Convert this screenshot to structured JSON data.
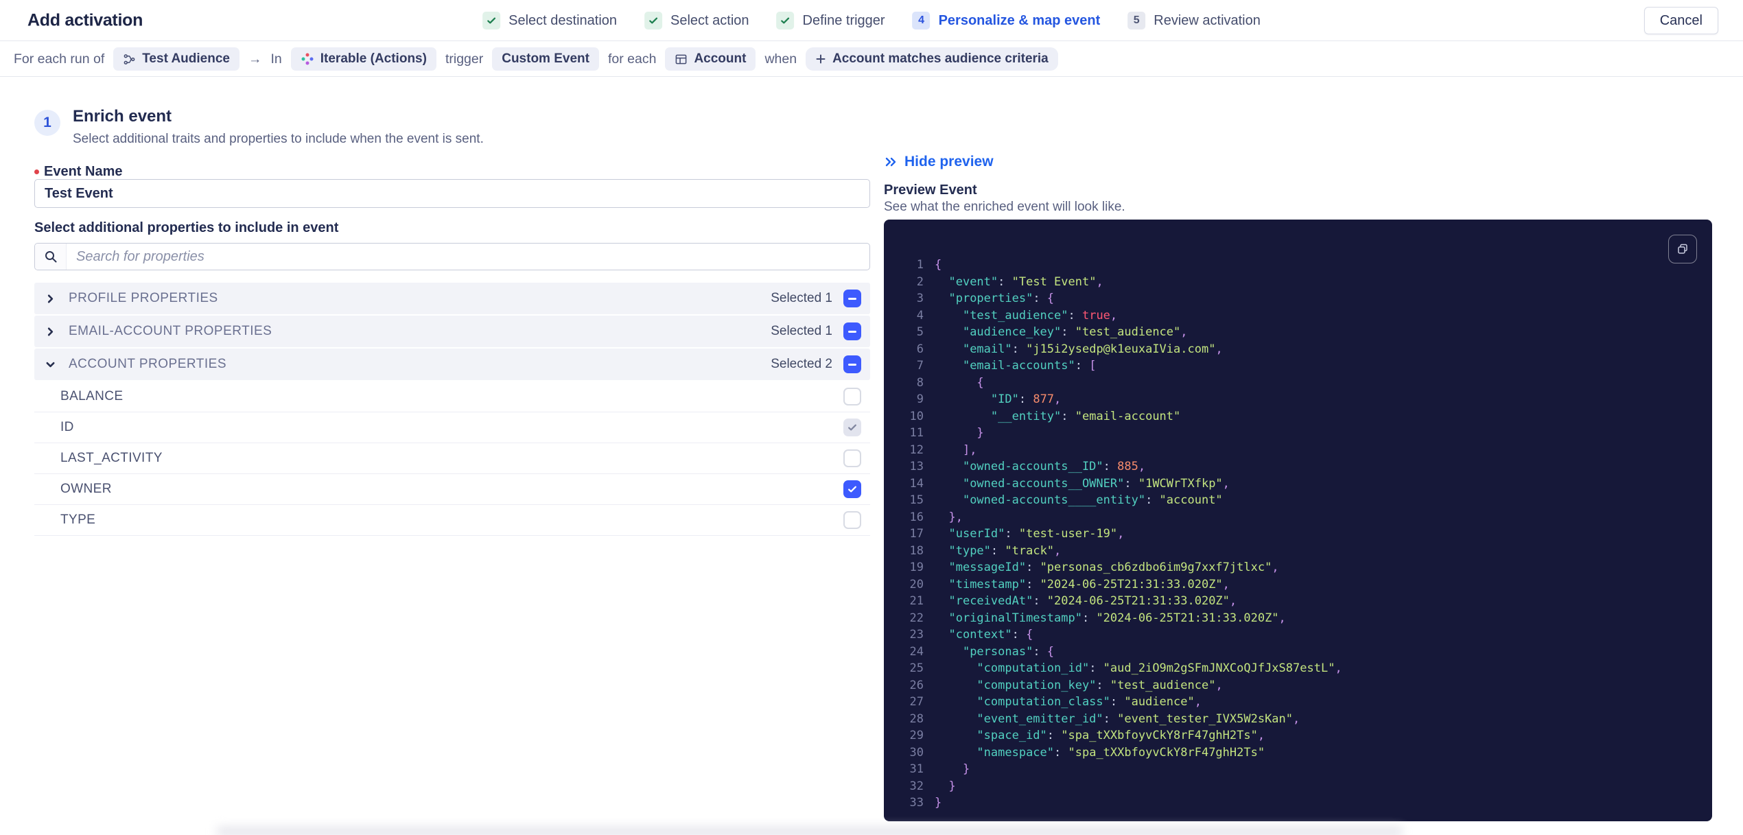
{
  "header": {
    "title": "Add activation",
    "cancel_label": "Cancel",
    "steps": [
      {
        "label": "Select destination",
        "state": "done",
        "number": ""
      },
      {
        "label": "Select action",
        "state": "done",
        "number": ""
      },
      {
        "label": "Define trigger",
        "state": "done",
        "number": ""
      },
      {
        "label": "Personalize & map event",
        "state": "active",
        "number": "4"
      },
      {
        "label": "Review activation",
        "state": "upcoming",
        "number": "5"
      }
    ]
  },
  "trigger_bar": {
    "prefix": "For each run of",
    "audience_chip": "Test Audience",
    "arrow": "→",
    "in_label": "In",
    "destination_chip": "Iterable (Actions)",
    "trigger_label": "trigger",
    "event_chip": "Custom Event",
    "for_each_label": "for each",
    "entity_chip": "Account",
    "when_label": "when",
    "condition_chip": "Account matches audience criteria"
  },
  "enrich": {
    "step_number": "1",
    "title": "Enrich event",
    "subtitle": "Select additional traits and properties to include when the event is sent.",
    "event_name_label": "Event Name",
    "event_name_value": "Test Event",
    "properties_label": "Select additional properties to include in event",
    "search_placeholder": "Search for properties",
    "groups": [
      {
        "label": "PROFILE PROPERTIES",
        "selected": "Selected 1",
        "expanded": false,
        "items": []
      },
      {
        "label": "EMAIL-ACCOUNT PROPERTIES",
        "selected": "Selected 1",
        "expanded": false,
        "items": []
      },
      {
        "label": "ACCOUNT PROPERTIES",
        "selected": "Selected 2",
        "expanded": true,
        "items": [
          {
            "label": "BALANCE",
            "state": "unchecked"
          },
          {
            "label": "ID",
            "state": "checked-disabled"
          },
          {
            "label": "LAST_ACTIVITY",
            "state": "unchecked"
          },
          {
            "label": "OWNER",
            "state": "checked"
          },
          {
            "label": "TYPE",
            "state": "unchecked"
          }
        ]
      }
    ]
  },
  "preview": {
    "hide_label": "Hide preview",
    "title": "Preview Event",
    "subtitle": "See what the enriched event will look like.",
    "code_lines": [
      [
        [
          "p",
          "{"
        ]
      ],
      [
        [
          "w",
          "  "
        ],
        [
          "k",
          "\"event\""
        ],
        [
          "o",
          ": "
        ],
        [
          "s",
          "\"Test Event\""
        ],
        [
          "p",
          ","
        ]
      ],
      [
        [
          "w",
          "  "
        ],
        [
          "k",
          "\"properties\""
        ],
        [
          "o",
          ": "
        ],
        [
          "p",
          "{"
        ]
      ],
      [
        [
          "w",
          "    "
        ],
        [
          "k",
          "\"test_audience\""
        ],
        [
          "o",
          ": "
        ],
        [
          "b",
          "true"
        ],
        [
          "p",
          ","
        ]
      ],
      [
        [
          "w",
          "    "
        ],
        [
          "k",
          "\"audience_key\""
        ],
        [
          "o",
          ": "
        ],
        [
          "s",
          "\"test_audience\""
        ],
        [
          "p",
          ","
        ]
      ],
      [
        [
          "w",
          "    "
        ],
        [
          "k",
          "\"email\""
        ],
        [
          "o",
          ": "
        ],
        [
          "s",
          "\"j15i2ysedp@k1euxaIVia.com\""
        ],
        [
          "p",
          ","
        ]
      ],
      [
        [
          "w",
          "    "
        ],
        [
          "k",
          "\"email-accounts\""
        ],
        [
          "o",
          ": "
        ],
        [
          "p",
          "["
        ]
      ],
      [
        [
          "w",
          "      "
        ],
        [
          "p",
          "{"
        ]
      ],
      [
        [
          "w",
          "        "
        ],
        [
          "k",
          "\"ID\""
        ],
        [
          "o",
          ": "
        ],
        [
          "n",
          "877"
        ],
        [
          "p",
          ","
        ]
      ],
      [
        [
          "w",
          "        "
        ],
        [
          "k",
          "\"__entity\""
        ],
        [
          "o",
          ": "
        ],
        [
          "s",
          "\"email-account\""
        ]
      ],
      [
        [
          "w",
          "      "
        ],
        [
          "p",
          "}"
        ]
      ],
      [
        [
          "w",
          "    "
        ],
        [
          "p",
          "],"
        ]
      ],
      [
        [
          "w",
          "    "
        ],
        [
          "k",
          "\"owned-accounts__ID\""
        ],
        [
          "o",
          ": "
        ],
        [
          "n",
          "885"
        ],
        [
          "p",
          ","
        ]
      ],
      [
        [
          "w",
          "    "
        ],
        [
          "k",
          "\"owned-accounts__OWNER\""
        ],
        [
          "o",
          ": "
        ],
        [
          "s",
          "\"1WCWrTXfkp\""
        ],
        [
          "p",
          ","
        ]
      ],
      [
        [
          "w",
          "    "
        ],
        [
          "k",
          "\"owned-accounts____entity\""
        ],
        [
          "o",
          ": "
        ],
        [
          "s",
          "\"account\""
        ]
      ],
      [
        [
          "w",
          "  "
        ],
        [
          "p",
          "},"
        ]
      ],
      [
        [
          "w",
          "  "
        ],
        [
          "k",
          "\"userId\""
        ],
        [
          "o",
          ": "
        ],
        [
          "s",
          "\"test-user-19\""
        ],
        [
          "p",
          ","
        ]
      ],
      [
        [
          "w",
          "  "
        ],
        [
          "k",
          "\"type\""
        ],
        [
          "o",
          ": "
        ],
        [
          "s",
          "\"track\""
        ],
        [
          "p",
          ","
        ]
      ],
      [
        [
          "w",
          "  "
        ],
        [
          "k",
          "\"messageId\""
        ],
        [
          "o",
          ": "
        ],
        [
          "s",
          "\"personas_cb6zdbo6im9g7xxf7jtlxc\""
        ],
        [
          "p",
          ","
        ]
      ],
      [
        [
          "w",
          "  "
        ],
        [
          "k",
          "\"timestamp\""
        ],
        [
          "o",
          ": "
        ],
        [
          "s",
          "\"2024-06-25T21:31:33.020Z\""
        ],
        [
          "p",
          ","
        ]
      ],
      [
        [
          "w",
          "  "
        ],
        [
          "k",
          "\"receivedAt\""
        ],
        [
          "o",
          ": "
        ],
        [
          "s",
          "\"2024-06-25T21:31:33.020Z\""
        ],
        [
          "p",
          ","
        ]
      ],
      [
        [
          "w",
          "  "
        ],
        [
          "k",
          "\"originalTimestamp\""
        ],
        [
          "o",
          ": "
        ],
        [
          "s",
          "\"2024-06-25T21:31:33.020Z\""
        ],
        [
          "p",
          ","
        ]
      ],
      [
        [
          "w",
          "  "
        ],
        [
          "k",
          "\"context\""
        ],
        [
          "o",
          ": "
        ],
        [
          "p",
          "{"
        ]
      ],
      [
        [
          "w",
          "    "
        ],
        [
          "k",
          "\"personas\""
        ],
        [
          "o",
          ": "
        ],
        [
          "p",
          "{"
        ]
      ],
      [
        [
          "w",
          "      "
        ],
        [
          "k",
          "\"computation_id\""
        ],
        [
          "o",
          ": "
        ],
        [
          "s",
          "\"aud_2iO9m2gSFmJNXCoQJfJxS87estL\""
        ],
        [
          "p",
          ","
        ]
      ],
      [
        [
          "w",
          "      "
        ],
        [
          "k",
          "\"computation_key\""
        ],
        [
          "o",
          ": "
        ],
        [
          "s",
          "\"test_audience\""
        ],
        [
          "p",
          ","
        ]
      ],
      [
        [
          "w",
          "      "
        ],
        [
          "k",
          "\"computation_class\""
        ],
        [
          "o",
          ": "
        ],
        [
          "s",
          "\"audience\""
        ],
        [
          "p",
          ","
        ]
      ],
      [
        [
          "w",
          "      "
        ],
        [
          "k",
          "\"event_emitter_id\""
        ],
        [
          "o",
          ": "
        ],
        [
          "s",
          "\"event_tester_IVX5W2sKan\""
        ],
        [
          "p",
          ","
        ]
      ],
      [
        [
          "w",
          "      "
        ],
        [
          "k",
          "\"space_id\""
        ],
        [
          "o",
          ": "
        ],
        [
          "s",
          "\"spa_tXXbfoyvCkY8rF47ghH2Ts\""
        ],
        [
          "p",
          ","
        ]
      ],
      [
        [
          "w",
          "      "
        ],
        [
          "k",
          "\"namespace\""
        ],
        [
          "o",
          ": "
        ],
        [
          "s",
          "\"spa_tXXbfoyvCkY8rF47ghH2Ts\""
        ]
      ],
      [
        [
          "w",
          "    "
        ],
        [
          "p",
          "}"
        ]
      ],
      [
        [
          "w",
          "  "
        ],
        [
          "p",
          "}"
        ]
      ],
      [
        [
          "p",
          "}"
        ]
      ]
    ]
  },
  "colors": {
    "accent_blue": "#3d5afe",
    "link_blue": "#1f63ee",
    "step_done_green": "#1d7f4f",
    "code_panel_bg": "#161839",
    "code_key": "#52d0c0",
    "code_string": "#c3e47f",
    "code_number": "#f78c6c",
    "code_boolean": "#ff5874",
    "code_brace": "#c792ea",
    "required_red": "#e0434b"
  }
}
